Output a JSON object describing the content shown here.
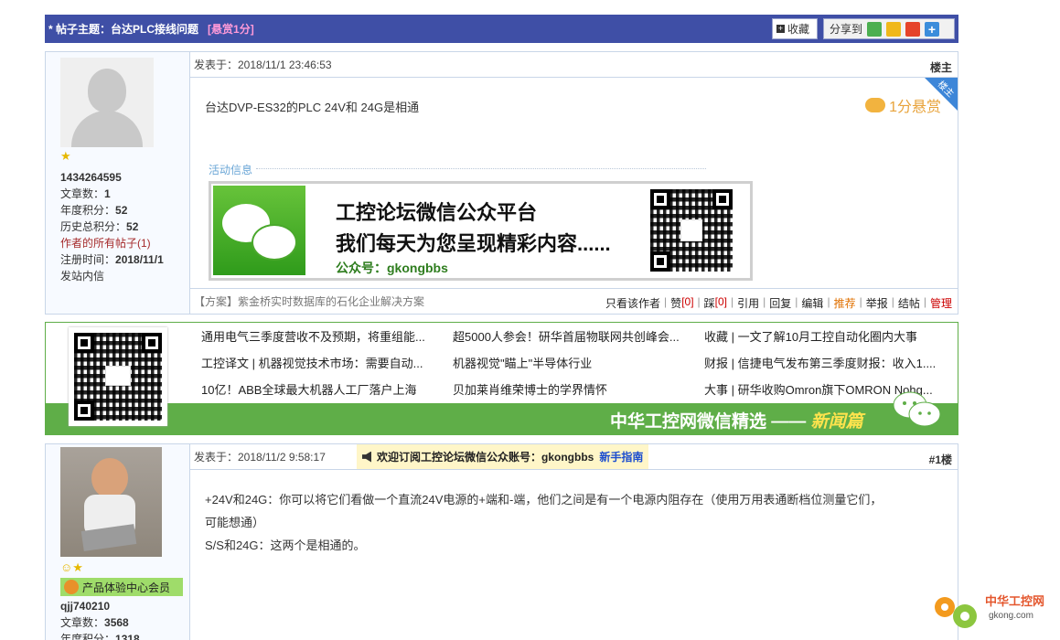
{
  "topic": {
    "prefix": "* 帖子主题：",
    "title": "台达PLC接线问题",
    "reward": "[悬赏1分]",
    "favorite_label": "收藏",
    "share_label": "分享到"
  },
  "post1": {
    "author": {
      "stars": "★",
      "username": "1434264595",
      "stats": [
        {
          "label": "文章数：",
          "value": "1"
        },
        {
          "label": "年度积分：",
          "value": "52"
        },
        {
          "label": "历史总积分：",
          "value": "52"
        }
      ],
      "all_posts": "作者的所有帖子(1)",
      "register": {
        "label": "注册时间：",
        "value": "2018/11/1"
      },
      "message": "发站内信"
    },
    "posted_at": "发表于：2018/11/1 23:46:53",
    "floor": "楼主",
    "corner": "楼主",
    "reward_badge": "1分悬赏",
    "text": "台达DVP-ES32的PLC 24V和 24G是相通",
    "activity_label": "活动信息",
    "banner": {
      "line1": "工控论坛微信公众平台",
      "line2": "我们每天为您呈现精彩内容......",
      "line3": "公众号：gkongbbs"
    },
    "footer_link": "【方案】紫金桥实时数据库的石化企业解决方案",
    "actions": {
      "only_author": "只看该作者",
      "like": "赞",
      "like_count": "[0]",
      "dislike": "踩",
      "dislike_count": "[0]",
      "quote": "引用",
      "reply": "回复",
      "edit": "编辑",
      "recommend": "推荐",
      "report": "举报",
      "close": "结帖",
      "manage": "管理"
    }
  },
  "promo": {
    "rows": [
      [
        "通用电气三季度营收不及预期，将重组能...",
        "超5000人参会！研华首届物联网共创峰会...",
        "收藏 | 一文了解10月工控自动化圈内大事"
      ],
      [
        "工控译文 | 机器视觉技术市场：需要自动...",
        "机器视觉\"瞄上\"半导体行业",
        "财报 | 信捷电气发布第三季度财报：收入1...."
      ],
      [
        "10亿！ABB全球最大机器人工厂落户上海",
        "贝加莱肖维荣博士的学界情怀",
        "大事 | 研华收购Omron旗下OMRON Nohg..."
      ]
    ],
    "slogan": "中华工控网微信精选 ——",
    "slogan_em": "新闻篇"
  },
  "post2": {
    "author": {
      "username": "qjj740210",
      "badge": "产品体验中心会员",
      "stats": [
        {
          "label": "文章数：",
          "value": "3568"
        },
        {
          "label": "年度积分：",
          "value": "1318"
        }
      ]
    },
    "posted_at": "发表于：2018/11/2 9:58:17",
    "notice": "欢迎订阅工控论坛微信公众账号：gkongbbs",
    "notice_link": "新手指南",
    "floor": "#1楼",
    "text_lines": [
      "+24V和24G：你可以将它们看做一个直流24V电源的+端和-端，他们之间是有一个电源内阻存在（使用万用表通断档位测量它们，",
      "可能想通）",
      "S/S和24G：这两个是相通的。"
    ]
  },
  "site_logo": {
    "name": "中华工控网",
    "url": "gkong.com"
  },
  "colors": {
    "topic_bar": "#3f4fa6",
    "border": "#c9d6e8",
    "promo_green": "#5fae48",
    "reward_orange": "#e8a33b"
  }
}
